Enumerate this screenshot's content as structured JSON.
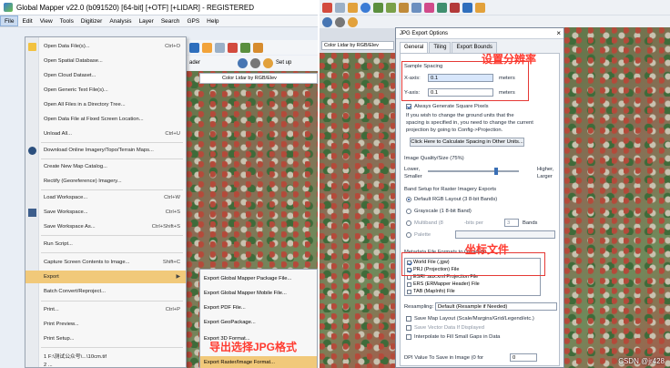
{
  "left": {
    "title": "Global Mapper v22.0 (b091520) [64-bit] [+OTF] [+LIDAR] - REGISTERED",
    "menubar": [
      "File",
      "Edit",
      "View",
      "Tools",
      "Digitizer",
      "Analysis",
      "Layer",
      "Search",
      "GPS",
      "Help"
    ],
    "layer_dropdown": "Color Lidar by RGB/Elev",
    "file_menu": [
      {
        "label": "Open Data File(s)...",
        "shortcut": "Ctrl+O"
      },
      {
        "label": "Open Spatial Database...",
        "shortcut": ""
      },
      {
        "label": "Open Cloud Dataset...",
        "shortcut": ""
      },
      {
        "label": "Open Generic Text File(s)...",
        "shortcut": ""
      },
      {
        "label": "Open All Files in a Directory Tree...",
        "shortcut": ""
      },
      {
        "label": "Open Data File at Fixed Screen Location...",
        "shortcut": ""
      },
      {
        "label": "Unload All...",
        "shortcut": "Ctrl+U"
      },
      {
        "label": "Download Online Imagery/Topo/Terrain Maps...",
        "shortcut": ""
      },
      {
        "label": "Create New Map Catalog...",
        "shortcut": ""
      },
      {
        "label": "Rectify (Georeference) Imagery...",
        "shortcut": ""
      },
      {
        "label": "Load Workspace...",
        "shortcut": "Ctrl+W"
      },
      {
        "label": "Save Workspace...",
        "shortcut": "Ctrl+S"
      },
      {
        "label": "Save Workspace As...",
        "shortcut": "Ctrl+Shift+S"
      },
      {
        "label": "Run Script...",
        "shortcut": ""
      },
      {
        "label": "Capture Screen Contents to Image...",
        "shortcut": "Shift+C"
      },
      {
        "label": "Export",
        "shortcut": "▶"
      },
      {
        "label": "Batch Convert/Reproject...",
        "shortcut": ""
      },
      {
        "label": "Print...",
        "shortcut": "Ctrl+P"
      },
      {
        "label": "Print Preview...",
        "shortcut": ""
      },
      {
        "label": "Print Setup...",
        "shortcut": ""
      },
      {
        "label": "1 F:\\测试公众号\\...\\10cm.tif",
        "shortcut": ""
      },
      {
        "label": "2 ...",
        "shortcut": ""
      }
    ],
    "export_submenu": [
      "Export Global Mapper Package File...",
      "Export Global Mapper Mobile File...",
      "Export PDF File...",
      "Export GeoPackage...",
      "Export 3D Format...",
      "Export Raster/Image Format..."
    ],
    "annotation": "导出选择JPG格式"
  },
  "right": {
    "layer_dropdown": "Color Lidar by RGB/Elev",
    "dialog_title": "JPG Export Options",
    "tabs": [
      "General",
      "Tiling",
      "Export Bounds"
    ],
    "annotation_resolution": "设置分辨率",
    "annotation_coord": "坐标文件",
    "sample_spacing": "Sample Spacing",
    "x_axis_label": "X-axis:",
    "x_axis_value": "0.1",
    "y_axis_label": "Y-axis:",
    "y_axis_value": "0.1",
    "units": "meters",
    "square_pixels": "Always Generate Square Pixels",
    "help_text_1": "If you wish to change the ground units that the",
    "help_text_2": "spacing is specified in, you need to change the current",
    "help_text_3": "projection by going to Config->Projection.",
    "calc_button": "Click Here to Calculate Spacing in Other Units...",
    "quality_label": "Image Quality/Size (75%)",
    "lower": "Lower,",
    "smaller": "Smaller",
    "higher": "Higher,",
    "larger": "Larger",
    "quality_value": 0.75,
    "band_setup": "Band Setup for Raster Imagery Exports",
    "band_default": "Default RGB Layout (3 8-bit Bands)",
    "band_gray": "Grayscale (1 8-bit Band)",
    "band_multi": "Multiband (8",
    "bits_per": "-bits per",
    "bands_num": "3",
    "bands_label": "Bands",
    "palette": "Palette",
    "metadata_label": "Metadata File Formats to Generate",
    "metadata_files": [
      {
        "label": "World File (.jgw)",
        "checked": true
      },
      {
        "label": "PRJ (Projection) File",
        "checked": true
      },
      {
        "label": "ESRI .aux.xml Projection File",
        "checked": false
      },
      {
        "label": "ERS (ERMapper Header) File",
        "checked": false
      },
      {
        "label": "TAB (MapInfo) File",
        "checked": false
      }
    ],
    "resampling_label": "Resampling:",
    "resampling_value": "Default (Resample if Needed)",
    "save_layout": "Save Map Layout (Scale/Margins/Grid/Legend/etc.)",
    "save_vector": "Save Vector Data If Displayed",
    "interpolate": "Interpolate to Fill Small Gaps in Data",
    "dpi_label": "DPI Value To Save in Image (0 for",
    "dpi_value": "0"
  },
  "watermark": "CSDN @jr428"
}
